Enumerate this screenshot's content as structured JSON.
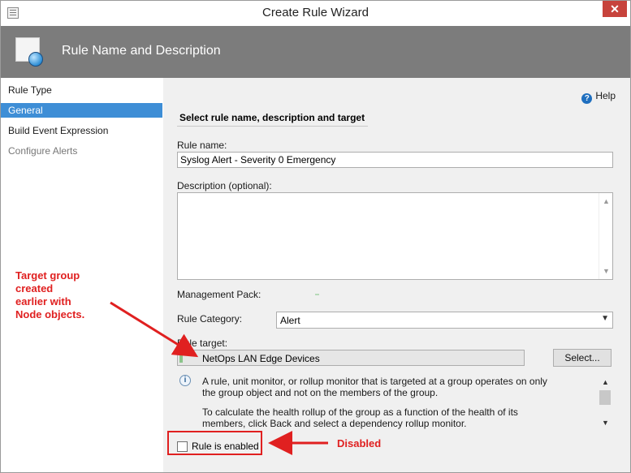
{
  "window": {
    "title": "Create Rule Wizard",
    "close_label": "✕"
  },
  "banner": {
    "title": "Rule Name and Description"
  },
  "nav": {
    "items": [
      {
        "label": "Rule Type"
      },
      {
        "label": "General"
      },
      {
        "label": "Build Event Expression"
      },
      {
        "label": "Configure Alerts"
      }
    ],
    "selected": "General"
  },
  "content": {
    "help_label": "Help",
    "section_title": "Select rule name, description and target",
    "rule_name": {
      "label": "Rule name:",
      "value": "Syslog Alert - Severity 0 Emergency"
    },
    "description": {
      "label": "Description (optional):",
      "value": ""
    },
    "management_pack": {
      "label": "Management Pack:"
    },
    "rule_category": {
      "label": "Rule Category:",
      "value": "Alert"
    },
    "rule_target": {
      "label": "Rule target:",
      "value": "NetOps LAN Edge Devices",
      "button_label": "Select..."
    },
    "info": {
      "line1": "A rule, unit monitor, or rollup monitor that is targeted at a group operates on only",
      "line2": "the group object and not on the members of the group.",
      "line3": "To calculate the health rollup of the group as a function of the health of its",
      "line4": "members, click Back and select a dependency rollup monitor."
    },
    "rule_enabled": {
      "label": "Rule is enabled",
      "checked": false
    }
  },
  "annotations": {
    "target_note": [
      "Target group",
      "created",
      "earlier with",
      "Node objects."
    ],
    "disabled_note": "Disabled",
    "color": "#e02020"
  }
}
